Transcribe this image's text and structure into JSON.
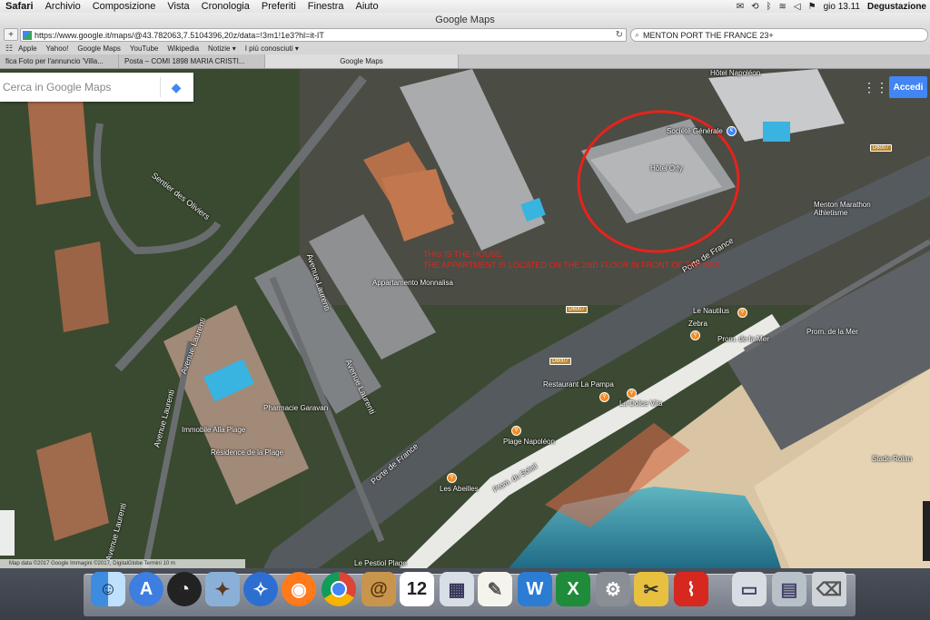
{
  "menubar": {
    "apple": "",
    "items": [
      "Safari",
      "Archivio",
      "Composizione",
      "Vista",
      "Cronologia",
      "Preferiti",
      "Finestra",
      "Aiuto"
    ],
    "clock": "gio 13.11",
    "user": "Degustazione"
  },
  "window": {
    "title": "Google Maps"
  },
  "toolbar": {
    "url": "https://www.google.it/maps/@43.782063,7.5104396,20z/data=!3m1!1e3?hl=it-IT",
    "search_value": "MENTON PORT THE FRANCE 23+"
  },
  "bookmarks": [
    "Apple",
    "Yahoo!",
    "Google Maps",
    "YouTube",
    "Wikipedia",
    "Notizie ▾",
    "I più conosciuti ▾"
  ],
  "tabs": [
    {
      "label": "fica Foto per l'annuncio 'Villa..."
    },
    {
      "label": "Posta – COMI 1898 MARIA CRISTI..."
    },
    {
      "label": "Google Maps"
    }
  ],
  "map": {
    "search_placeholder": "Cerca in Google Maps",
    "signin_label": "Accedi",
    "annotation_line1": "THIS IS THE HOUSE",
    "annotation_line2": "THE APPARTMENT IS LOCATED ON THE 2ND FLOOR IN FRONT OF THE SEA",
    "labels": {
      "hotel_napoleon": "Hôtel Napoléon",
      "societe_generale": "Société Générale",
      "hotel_orly": "Hôtel Orly",
      "menton_marathon": "Menton Marathon Athletisme",
      "porte_de_france_1": "Porte de France",
      "porte_de_france_2": "Porte de France",
      "appartamento": "Appartamento Monnalisa",
      "le_nautilus": "Le Nautilus",
      "zebra": "Zebra",
      "prom_mer_1": "Prom. de la Mer",
      "prom_mer_2": "Prom. de la Mer",
      "restaurant_pampa": "Restaurant La Pampa",
      "dolce_vita": "La Dolce Vita",
      "pharmacie": "Pharmacie Garavan",
      "immobile": "Immobile Alla Plage",
      "residence": "Résidence de la Plage",
      "plage_napoleon": "Plage Napoléon",
      "les_abeilles": "Les Abeilles",
      "prom_soleil": "Prom. du Soleil",
      "sentier": "Sentier des Oliviers",
      "avenue_laurenti_1": "Avenue Laurenti",
      "avenue_laurenti_2": "Avenue Laurenti",
      "avenue_laurenti_3": "Avenue Laurenti",
      "avenue_laurenti_4": "Avenue Laurenti",
      "avenue_laurenti_5": "Avenue Laurenti",
      "stade": "Stade Rolan",
      "d6007_a": "D6007",
      "d6007_b": "D6007",
      "d6007_c": "D6007",
      "le_pestiol": "Le Pestiol Plage"
    },
    "attribution": "Map data ©2017 Google Immagini ©2017, DigitalGlobe   Termini   10 m"
  },
  "dock": {
    "apps": [
      "finder-icon",
      "launchpad-icon",
      "dashboard-icon",
      "photo-icon",
      "safari-icon",
      "firefox-icon",
      "chrome-icon",
      "contacts-icon",
      "calendar-icon",
      "preview-icon",
      "textedit-icon",
      "word-icon",
      "excel-icon",
      "system-prefs-icon",
      "archive-icon",
      "acrobat-icon",
      "screenshot-icon",
      "downloads-icon",
      "trash-icon"
    ],
    "calendar_day": "12",
    "colors": {
      "word": "#2b7cd3",
      "excel": "#1e8c3a",
      "acrobat": "#d6281f",
      "firefox": "#ff7a1a",
      "chrome_red": "#db4437",
      "chrome_yellow": "#f4b400",
      "chrome_green": "#0f9d58",
      "chrome_blue": "#4285f4"
    }
  }
}
